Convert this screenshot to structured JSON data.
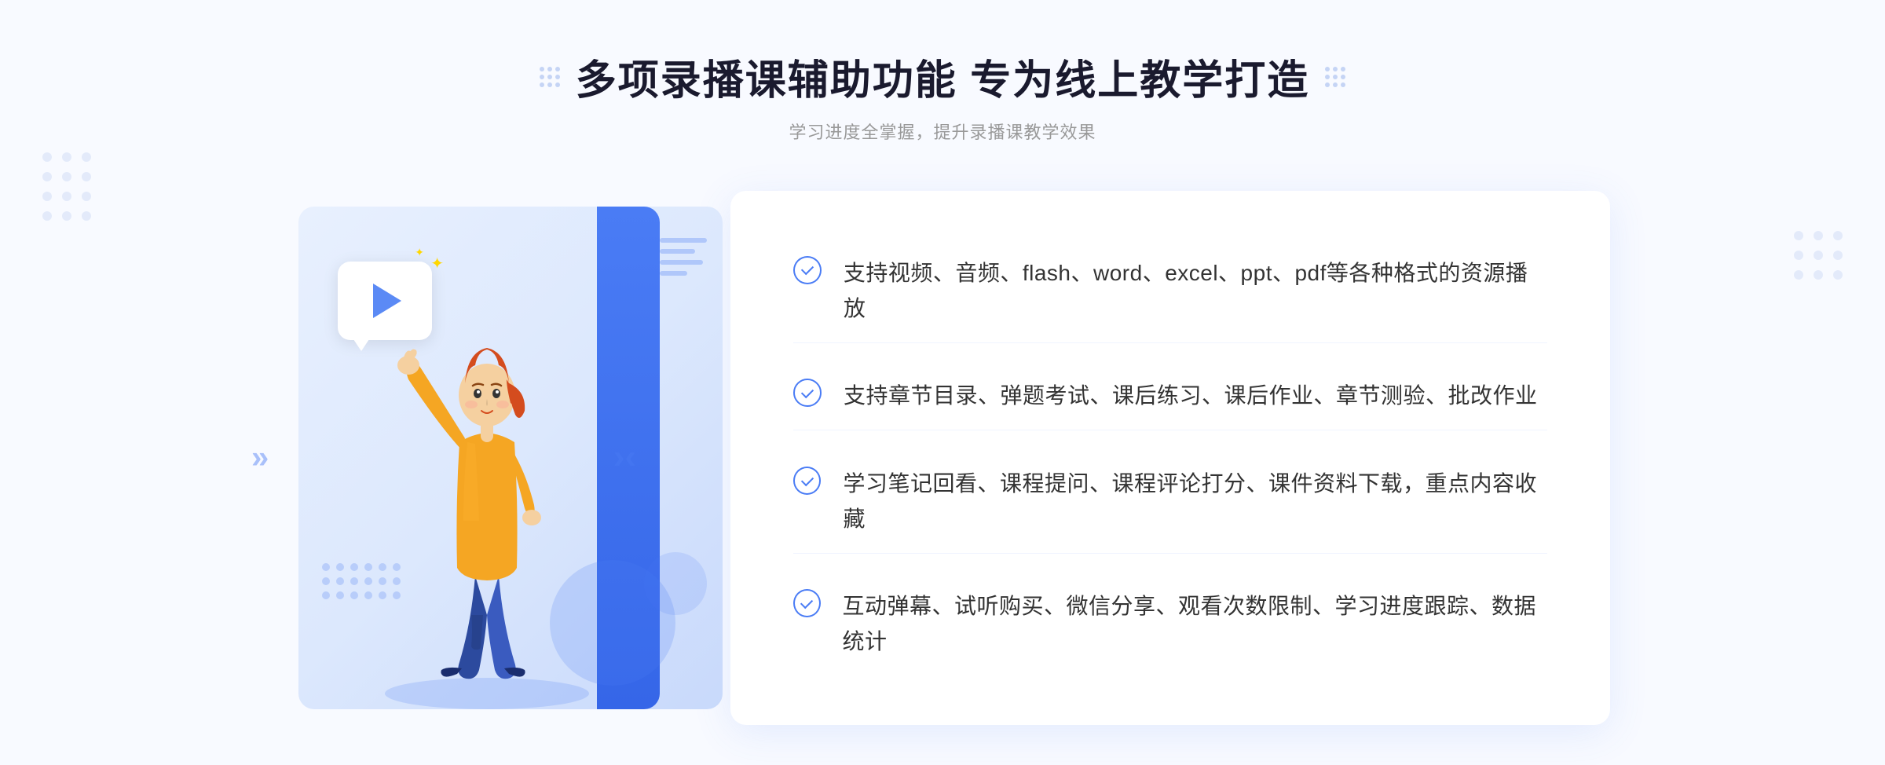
{
  "page": {
    "background": "#f8faff"
  },
  "header": {
    "title": "多项录播课辅助功能 专为线上教学打造",
    "subtitle": "学习进度全掌握，提升录播课教学效果"
  },
  "features": [
    {
      "id": 1,
      "text": "支持视频、音频、flash、word、excel、ppt、pdf等各种格式的资源播放"
    },
    {
      "id": 2,
      "text": "支持章节目录、弹题考试、课后练习、课后作业、章节测验、批改作业"
    },
    {
      "id": 3,
      "text": "学习笔记回看、课程提问、课程评论打分、课件资料下载，重点内容收藏"
    },
    {
      "id": 4,
      "text": "互动弹幕、试听购买、微信分享、观看次数限制、学习进度跟踪、数据统计"
    }
  ],
  "decorators": {
    "left_chevron": "»",
    "dot_color": "#c5d4f5",
    "accent_color": "#4a7cf5"
  }
}
